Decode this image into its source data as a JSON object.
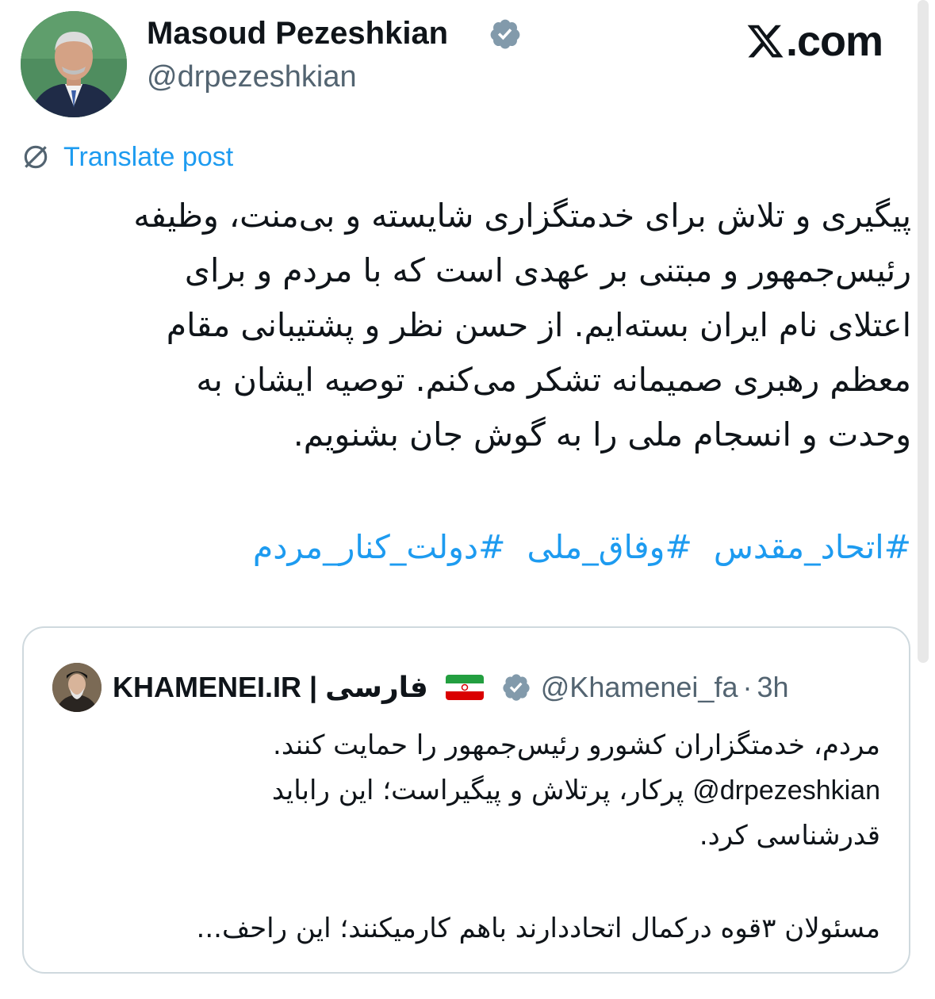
{
  "author": {
    "name": "Masoud Pezeshkian",
    "handle": "@drpezeshkian",
    "verified_icon": "verified-badge-icon",
    "verified_color": "#829aab"
  },
  "watermark": {
    "x_logo": "X",
    "domain": ".com"
  },
  "translate": {
    "icon": "globe-translate-icon",
    "label": "Translate post",
    "color": "#1d9bf0"
  },
  "post": {
    "lines": [
      "پیگیری و تلاش برای خدمتگزاری شایسته و بی‌منت، وظیفه",
      "رئیس‌جمهور و مبتنی بر عهدی است که با مردم و برای",
      "اعتلای نام ایران بسته‌ایم. از حسن نظر و پشتیبانی مقام",
      "معظم رهبری صمیمانه تشکر می‌کنم. توصیه ایشان به",
      "وحدت و انسجام ملی را به گوش جان بشنویم."
    ],
    "hashtags": [
      "#اتحاد_مقدس",
      "#وفاق_ملی",
      "#دولت_کنار_مردم"
    ]
  },
  "quoted": {
    "name_latin": "KHAMENEI.IR",
    "name_sep": "|",
    "name_fa": "فارسی",
    "flag_icon": "iran-flag-icon",
    "verified_icon": "verified-badge-icon",
    "handle": "@Khamenei_fa",
    "dot": "·",
    "time": "3h",
    "line1": "مردم، خدمتگزاران کشورو رئیس‌جمهور را حمایت کنند.",
    "line2_mention": "@drpezeshkian",
    "line2_rest": "پرکار، پرتلاش و پیگیراست؛ این رابايد",
    "line3": "قدرشناسی کرد.",
    "line4": "مسئولان ۳قوه درکمال اتحاددارند باهم کارمیکنند؛ این راحف..."
  }
}
